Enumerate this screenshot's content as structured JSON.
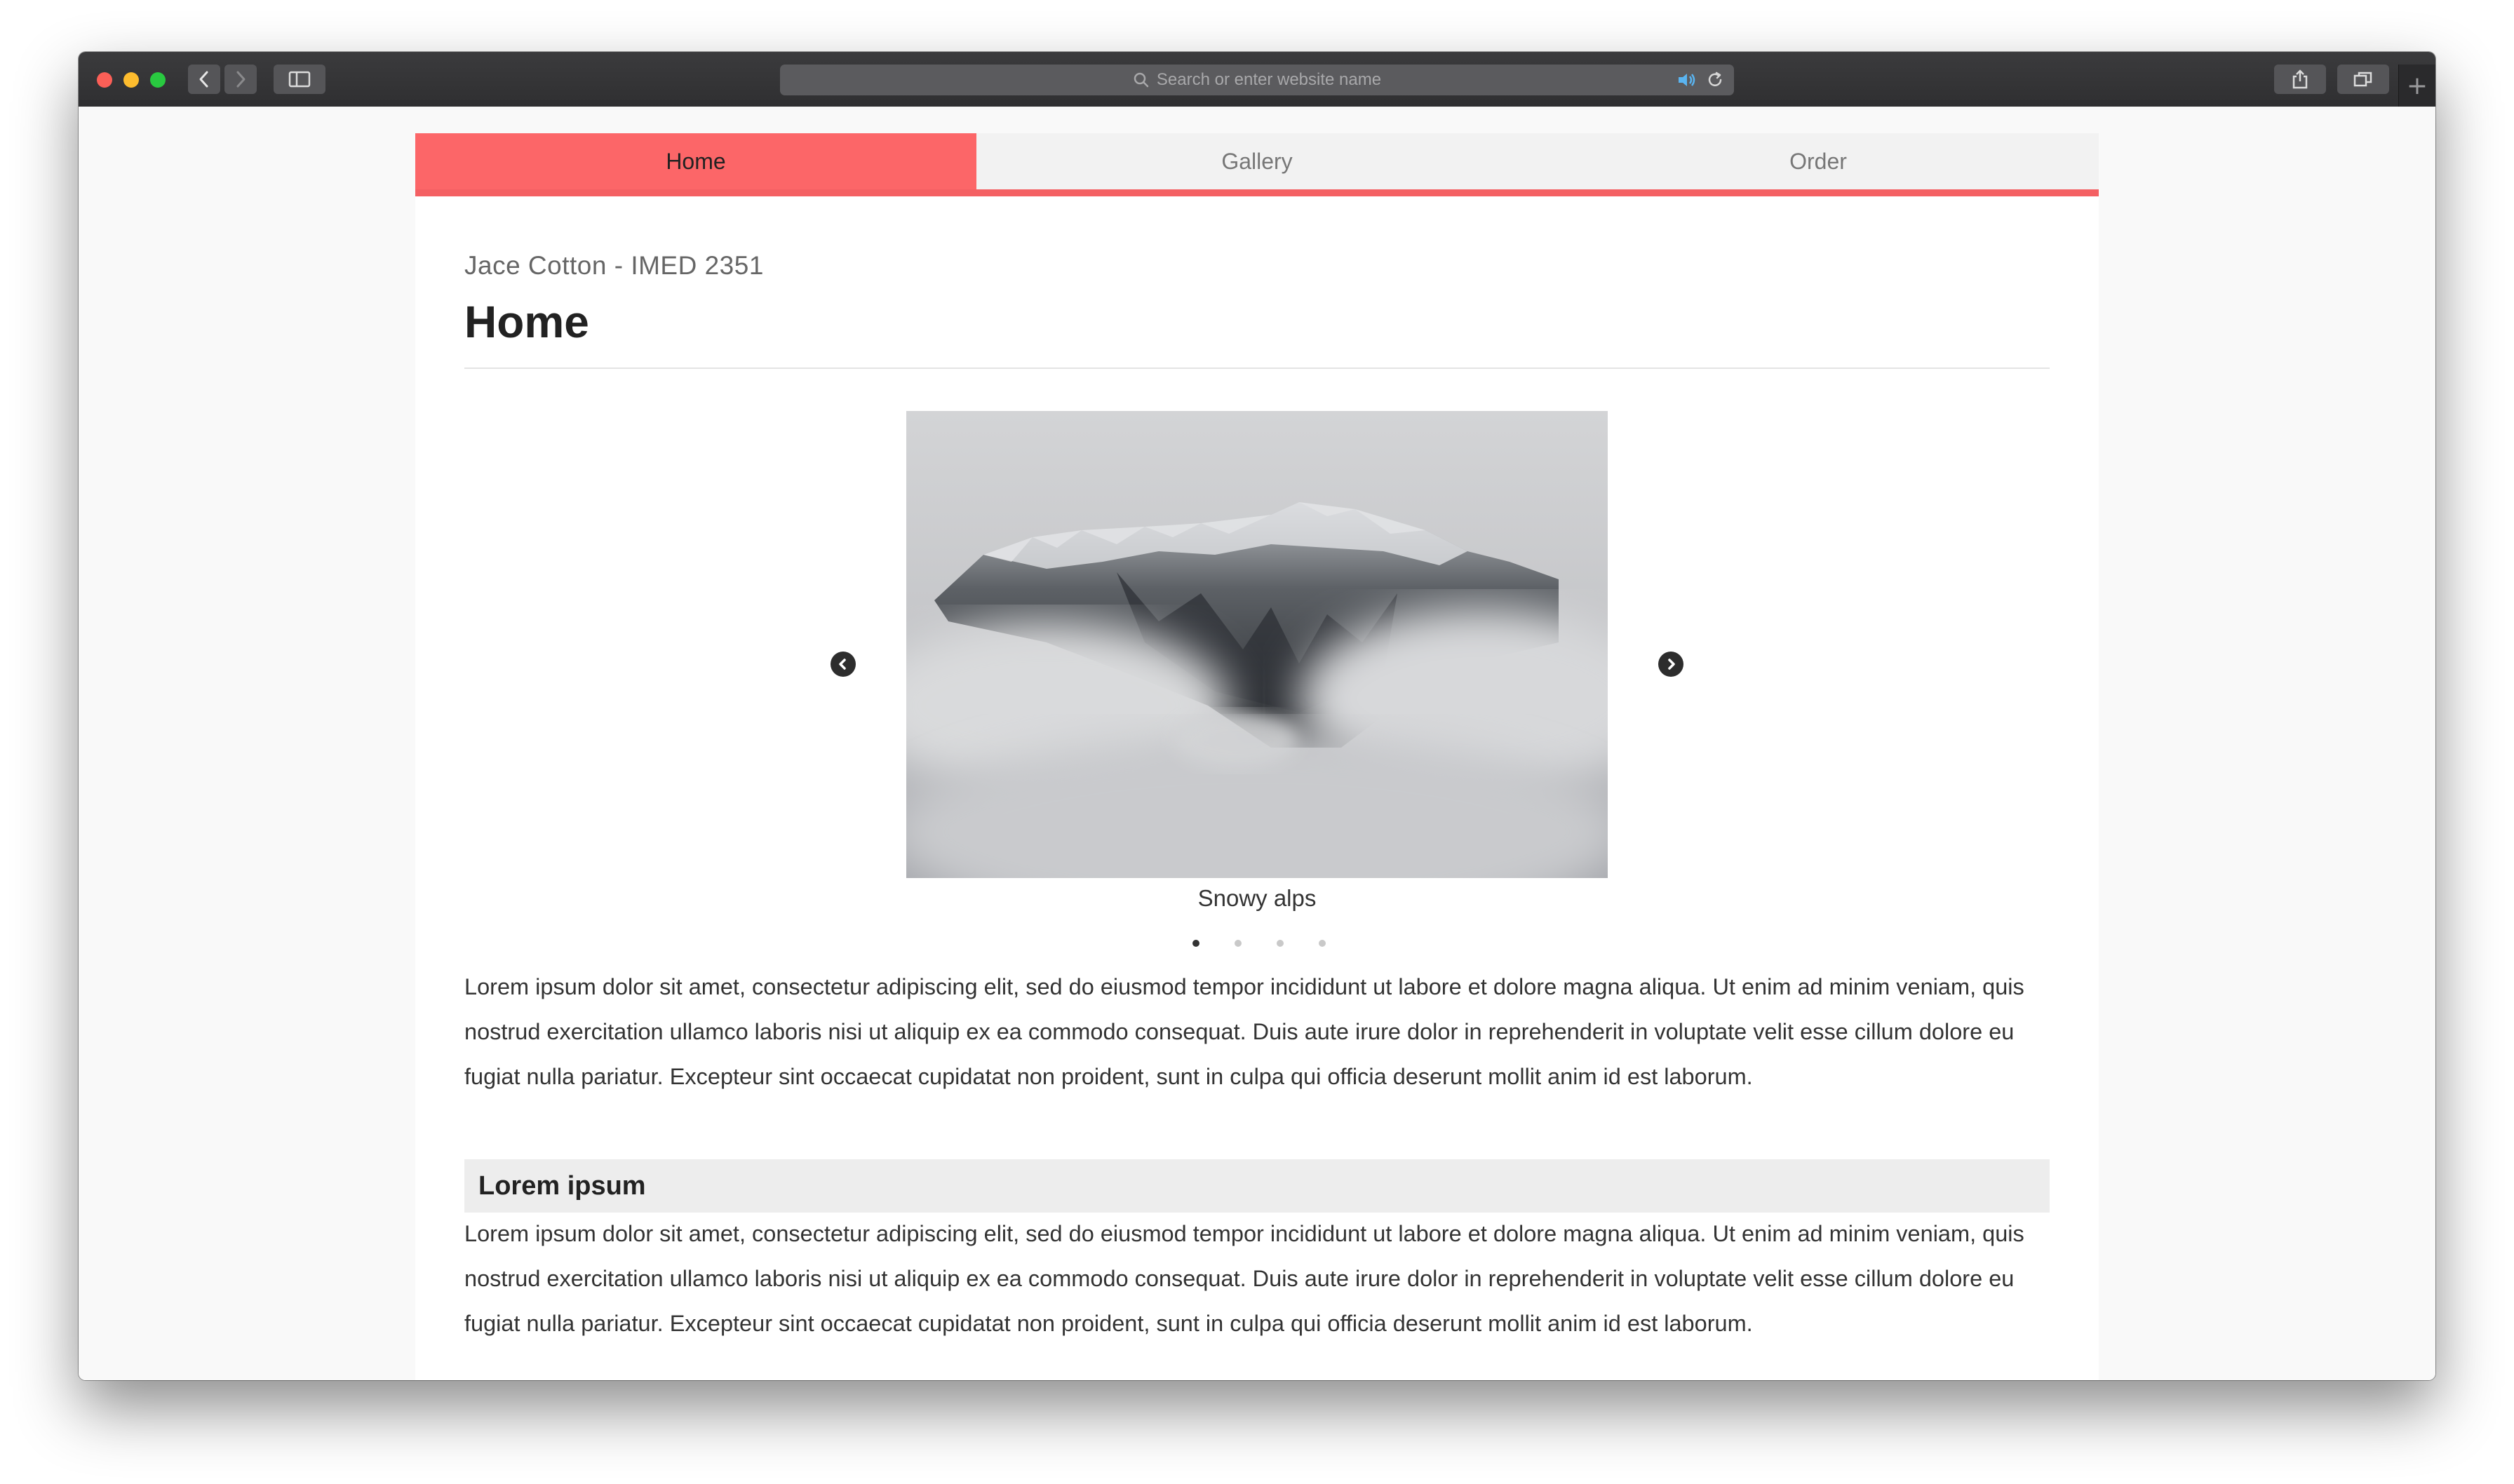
{
  "browser": {
    "address_placeholder": "Search or enter website name"
  },
  "nav": {
    "tabs": [
      {
        "label": "Home",
        "active": true
      },
      {
        "label": "Gallery",
        "active": false
      },
      {
        "label": "Order",
        "active": false
      }
    ]
  },
  "header": {
    "subtitle": "Jace Cotton - IMED 2351",
    "title": "Home"
  },
  "carousel": {
    "caption": "Snowy alps",
    "slide_count": 4,
    "active_index": 0
  },
  "content": {
    "paragraph_1": "Lorem ipsum dolor sit amet, consectetur adipiscing elit, sed do eiusmod tempor incididunt ut labore et dolore magna aliqua. Ut enim ad minim veniam, quis nostrud exercitation ullamco laboris nisi ut aliquip ex ea commodo consequat. Duis aute irure dolor in reprehenderit in voluptate velit esse cillum dolore eu fugiat nulla pariatur. Excepteur sint occaecat cupidatat non proident, sunt in culpa qui officia deserunt mollit anim id est laborum.",
    "section_title": "Lorem ipsum",
    "paragraph_2": "Lorem ipsum dolor sit amet, consectetur adipiscing elit, sed do eiusmod tempor incididunt ut labore et dolore magna aliqua. Ut enim ad minim veniam, quis nostrud exercitation ullamco laboris nisi ut aliquip ex ea commodo consequat. Duis aute irure dolor in reprehenderit in voluptate velit esse cillum dolore eu fugiat nulla pariatur. Excepteur sint occaecat cupidatat non proident, sunt in culpa qui officia deserunt mollit anim id est laborum."
  },
  "colors": {
    "accent": "#fc6668",
    "toolbar": "#333335"
  }
}
